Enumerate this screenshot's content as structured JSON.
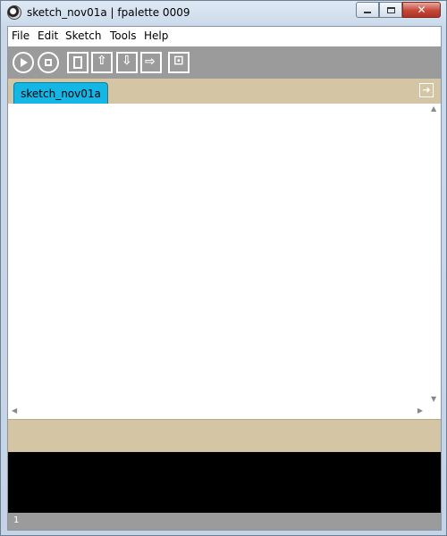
{
  "window": {
    "title": "sketch_nov01a | fpalette 0009",
    "icon": "processing-app-icon",
    "controls": [
      "minimize-icon",
      "maximize-icon",
      "close-icon"
    ]
  },
  "menu": {
    "items": [
      "File",
      "Edit",
      "Sketch",
      "Tools",
      "Help"
    ]
  },
  "toolbar": {
    "buttons": [
      "run-icon",
      "stop-icon",
      "new-icon",
      "open-icon",
      "save-icon",
      "export-icon",
      "export-application-icon"
    ]
  },
  "tabs": {
    "active": "sketch_nov01a",
    "menu_icon": "tab-menu-arrow-icon"
  },
  "editor": {
    "content": ""
  },
  "status": {
    "line_number": "1"
  },
  "colors": {
    "toolbar_bg": "#9b9b9b",
    "tab_bar_bg": "#d4c6a4",
    "active_tab": "#13b6e5",
    "console_bg": "#000000"
  }
}
